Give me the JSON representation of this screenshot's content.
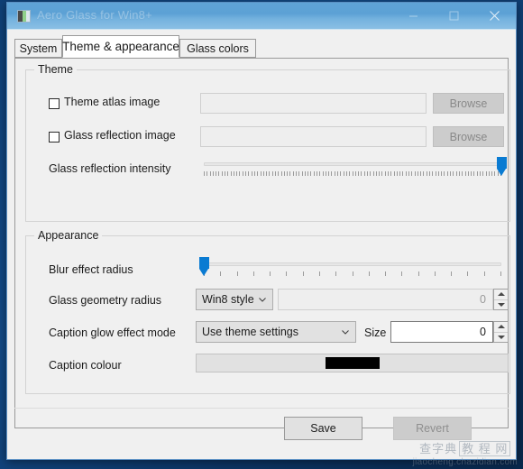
{
  "window": {
    "title": "Aero Glass for Win8+",
    "icon_name": "app-icon",
    "caption_buttons": {
      "minimize": "Minimize",
      "maximize": "Maximize",
      "close": "Close"
    }
  },
  "tabs": [
    {
      "label": "System",
      "active": false
    },
    {
      "label": "Theme & appearance",
      "active": true
    },
    {
      "label": "Glass colors",
      "active": false
    }
  ],
  "theme_group": {
    "legend": "Theme",
    "atlas": {
      "checkbox_label": "Theme atlas image",
      "checked": false,
      "path_value": "",
      "browse_label": "Browse",
      "enabled": false
    },
    "reflection": {
      "checkbox_label": "Glass reflection image",
      "checked": false,
      "path_value": "",
      "browse_label": "Browse",
      "enabled": false
    },
    "intensity": {
      "label": "Glass reflection intensity",
      "value_percent": 100,
      "tick_count": 100
    }
  },
  "appearance_group": {
    "legend": "Appearance",
    "blur": {
      "label": "Blur effect radius",
      "value_percent": 0,
      "tick_count": 18
    },
    "geometry": {
      "label": "Glass geometry radius",
      "combo_value": "Win8 style",
      "spin_value": "0",
      "spin_enabled": false
    },
    "glow": {
      "label": "Caption glow effect mode",
      "combo_value": "Use theme settings",
      "size_label": "Size",
      "size_value": "0",
      "size_enabled": true
    },
    "caption_colour": {
      "label": "Caption colour",
      "swatch_hex": "#000000"
    }
  },
  "footer": {
    "save_label": "Save",
    "revert_label": "Revert",
    "revert_enabled": false
  },
  "watermark": {
    "line1_a": "查字典",
    "line1_b": "教 程 网",
    "line2": "jiaocheng.chazidian.com"
  }
}
